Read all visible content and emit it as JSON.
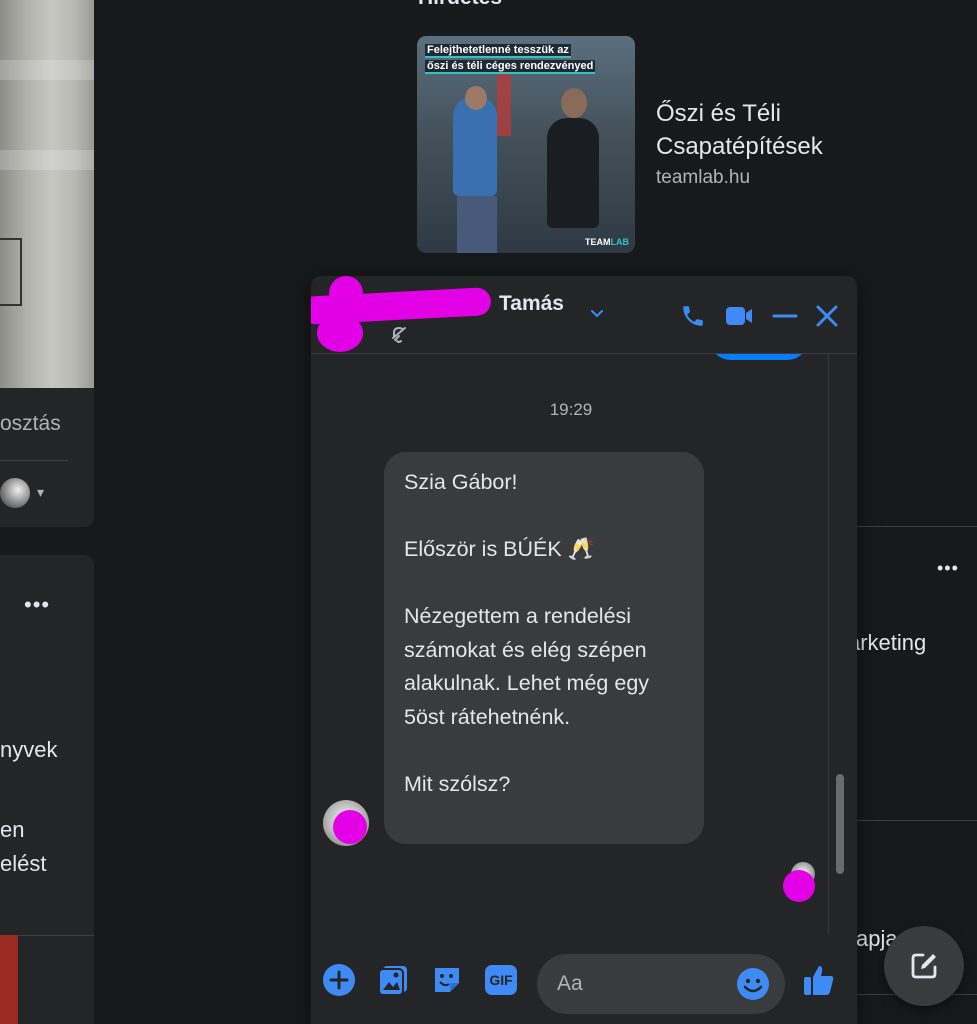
{
  "left_panel": {
    "share_label": "osztás",
    "text_line1": "nyvek",
    "text_line2": "en",
    "text_line3": "elést"
  },
  "ad": {
    "heading": "Hirdetés",
    "image_text_line1": "Felejthetetlenné tesszük az",
    "image_text_line2": "őszi és téli céges rendezvényed",
    "image_brand": "TEAM",
    "image_brand_accent": "LAB",
    "title": "Őszi és Téli Csapatépítések",
    "domain": "teamlab.hu"
  },
  "right_panel": {
    "marketing_text": "arketing",
    "bottom_text": "apja"
  },
  "chat": {
    "contact_name": "Tamás",
    "timestamp": "19:29",
    "message": "Szia Gábor!\n\nElőször is BÚÉK 🥂\n\nNézegettem a rendelési számokat és elég szépen alakulnak. Lehet még egy 5öst rátehetnénk.\n\nMit szólsz?",
    "input_placeholder": "Aa",
    "gif_label": "GIF"
  },
  "colors": {
    "accent": "#0a7cff",
    "icon_blue": "#3e8bf5",
    "redaction": "#e400e6",
    "background": "#18191a",
    "card": "#242526",
    "bubble": "#3a3b3c"
  },
  "icons": [
    "chevron-down-icon",
    "mute-icon",
    "phone-icon",
    "video-icon",
    "minimize-icon",
    "close-icon",
    "plus-icon",
    "image-icon",
    "sticker-icon",
    "gif-icon",
    "emoji-icon",
    "thumbs-up-icon",
    "new-message-icon"
  ]
}
